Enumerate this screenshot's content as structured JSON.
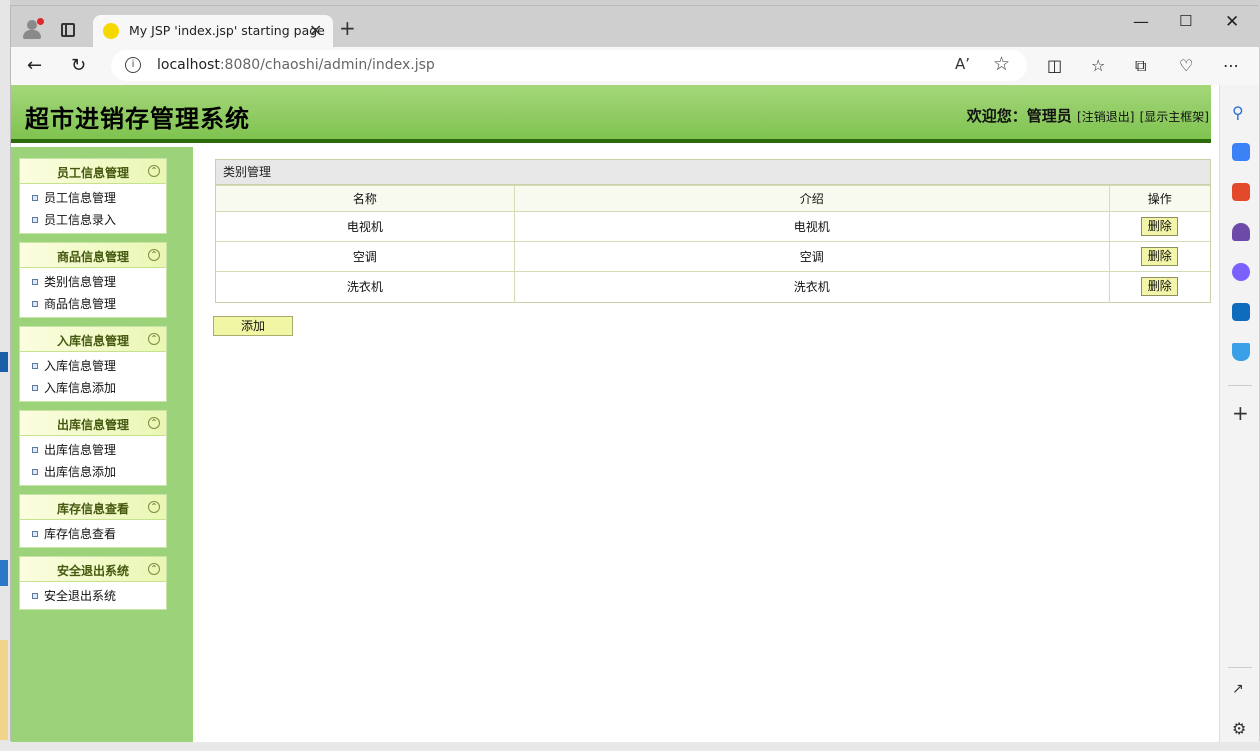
{
  "browser": {
    "tab_title": "My JSP 'index.jsp' starting page",
    "url_host": "localhost",
    "url_rest": ":8080/chaoshi/admin/index.jsp",
    "read_aloud": "A)"
  },
  "header": {
    "system_title": "超市进销存管理系统",
    "welcome_label": "欢迎您：管理员",
    "logout_link": "[注销退出]",
    "show_main_link": "[显示主框架]"
  },
  "sidebar": {
    "groups": [
      {
        "title": "员工信息管理",
        "items": [
          "员工信息管理",
          "员工信息录入"
        ]
      },
      {
        "title": "商品信息管理",
        "items": [
          "类别信息管理",
          "商品信息管理"
        ]
      },
      {
        "title": "入库信息管理",
        "items": [
          "入库信息管理",
          "入库信息添加"
        ]
      },
      {
        "title": "出库信息管理",
        "items": [
          "出库信息管理",
          "出库信息添加"
        ]
      },
      {
        "title": "库存信息查看",
        "items": [
          "库存信息查看"
        ]
      },
      {
        "title": "安全退出系统",
        "items": [
          "安全退出系统"
        ]
      }
    ]
  },
  "main": {
    "panel_title": "类别管理",
    "columns": [
      "名称",
      "介绍",
      "操作"
    ],
    "rows": [
      {
        "name": "电视机",
        "intro": "电视机",
        "action": "删除"
      },
      {
        "name": "空调",
        "intro": "空调",
        "action": "删除"
      },
      {
        "name": "洗衣机",
        "intro": "洗衣机",
        "action": "删除"
      }
    ],
    "add_label": "添加"
  }
}
